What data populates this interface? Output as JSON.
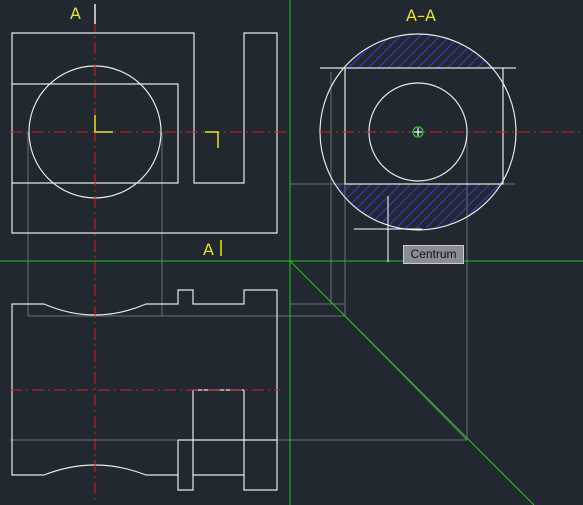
{
  "section_label_top_left": "A",
  "section_label_bottom": "A",
  "section_view_title": "A–A",
  "tooltip_text": "Centrum",
  "colors": {
    "background": "#212830",
    "geometry": "#e8e8e8",
    "construction": "#6c7078",
    "centerline": "#d02020",
    "crosshair": "#1ec81e",
    "hatch": "#2a2ab8",
    "label": "#e6e61e",
    "snap_marker": "#2ecc40"
  },
  "icons": [
    "center-snap-icon",
    "crosshair-cursor-icon"
  ]
}
